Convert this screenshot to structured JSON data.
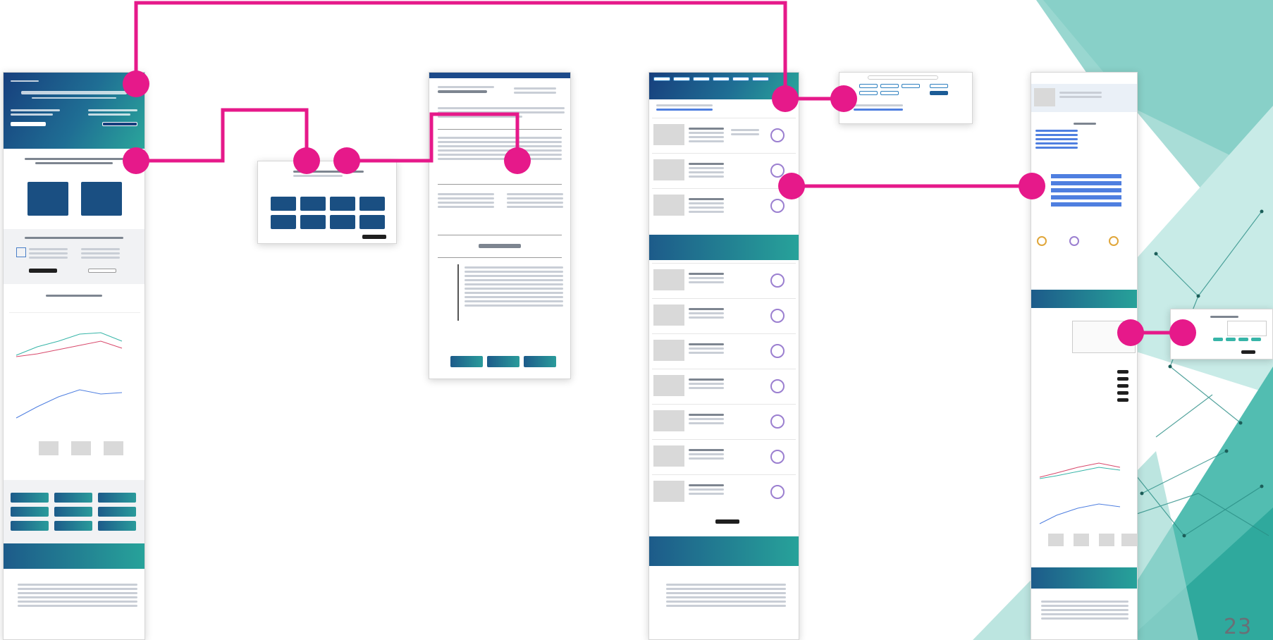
{
  "slide": {
    "page_number": "23"
  },
  "colors": {
    "connector": "#e6198a",
    "brand_blue": "#1c4a8a",
    "brand_teal": "#2aa69b",
    "deco_teal": "#5cc3b8"
  },
  "screens": [
    {
      "id": "landing-page"
    },
    {
      "id": "filter-dialog"
    },
    {
      "id": "course-detail"
    },
    {
      "id": "search-results"
    },
    {
      "id": "search-filter-bar"
    },
    {
      "id": "course-profile"
    },
    {
      "id": "course-dates-popup"
    }
  ],
  "icons": [
    "rocket-icon",
    "grid-icon",
    "network-deco"
  ]
}
